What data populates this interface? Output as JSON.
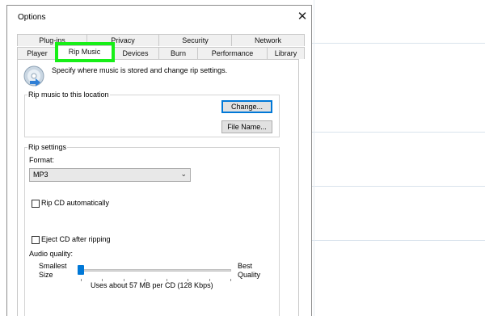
{
  "dialog": {
    "title": "Options",
    "close_glyph": "✕"
  },
  "tabs": {
    "top_row": [
      "Plug-ins",
      "Privacy",
      "Security",
      "Network"
    ],
    "bottom_row": [
      "Player",
      "Rip Music",
      "Devices",
      "Burn",
      "Performance",
      "Library"
    ],
    "active": "Rip Music"
  },
  "header": {
    "description": "Specify where music is stored and change rip settings.",
    "icon": "cd-rip-icon"
  },
  "location_group": {
    "label": "Rip music to this location",
    "change_button": "Change...",
    "file_name_button": "File Name..."
  },
  "rip_settings": {
    "label": "Rip settings",
    "format_label": "Format:",
    "format_value": "MP3",
    "rip_cd_auto": "Rip CD automatically",
    "rip_cd_auto_checked": false,
    "eject_after": "Eject CD after ripping",
    "eject_after_checked": false,
    "audio_quality_label": "Audio quality:",
    "smallest": "Smallest",
    "size": "Size",
    "best": "Best",
    "quality": "Quality",
    "usage_text": "Uses about 57 MB per CD (128 Kbps)",
    "slider_position": 0
  },
  "colors": {
    "highlight": "#17ef17",
    "accent": "#0078d7"
  }
}
